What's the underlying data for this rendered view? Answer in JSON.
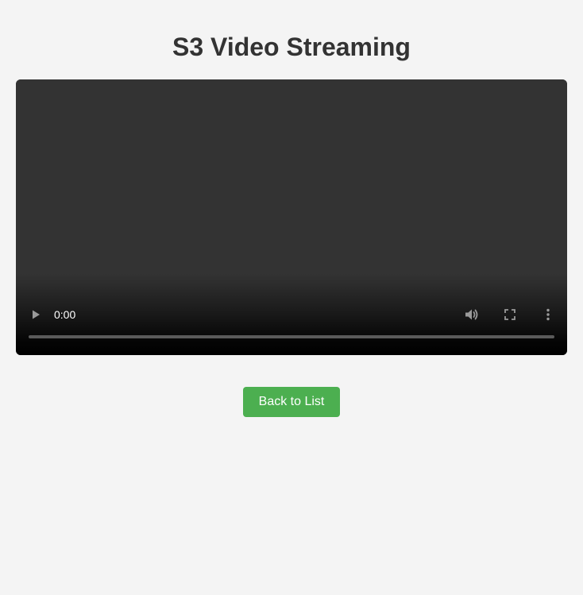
{
  "page": {
    "title": "S3 Video Streaming"
  },
  "player": {
    "current_time": "0:00",
    "progress_fraction": 0,
    "icons": {
      "play": "play-icon",
      "volume": "volume-icon",
      "fullscreen": "fullscreen-icon",
      "more": "more-options-icon"
    }
  },
  "actions": {
    "back_label": "Back to List"
  },
  "colors": {
    "background": "#f4f4f4",
    "title": "#333333",
    "video_surface": "#333333",
    "back_button": "#4caf50",
    "back_button_text": "#ffffff"
  }
}
